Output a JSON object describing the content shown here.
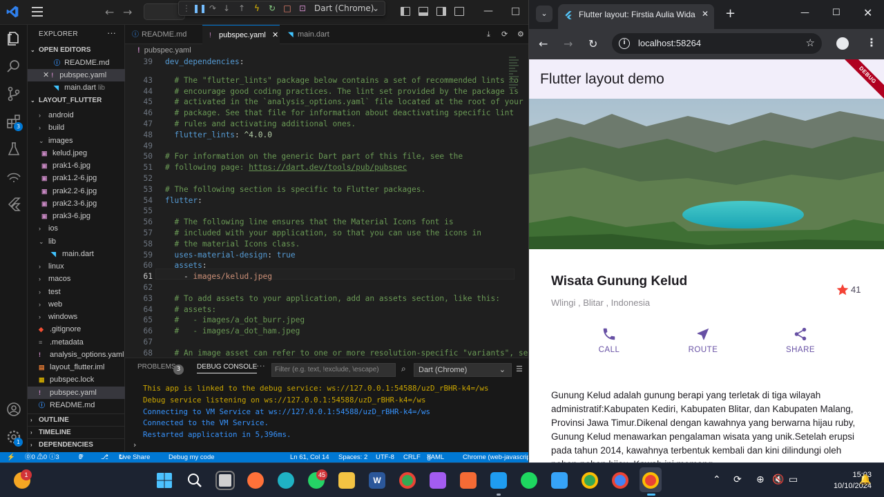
{
  "vscode": {
    "title_select": "Dart (Chrome)",
    "explorer_title": "EXPLORER",
    "open_editors_title": "OPEN EDITORS",
    "open_editors": [
      {
        "name": "README.md",
        "extra": ""
      },
      {
        "name": "pubspec.yaml",
        "extra": ""
      },
      {
        "name": "main.dart",
        "extra": "lib"
      }
    ],
    "project_title": "LAYOUT_FLUTTER",
    "tree": [
      {
        "name": "android",
        "type": "folder"
      },
      {
        "name": "build",
        "type": "folder"
      },
      {
        "name": "images",
        "type": "folder-open"
      },
      {
        "name": "kelud.jpeg",
        "type": "image"
      },
      {
        "name": "prak1-6.jpg",
        "type": "image"
      },
      {
        "name": "prak1.2-6.jpg",
        "type": "image"
      },
      {
        "name": "prak2.2-6.jpg",
        "type": "image"
      },
      {
        "name": "prak2.3-6.jpg",
        "type": "image"
      },
      {
        "name": "prak3-6.jpg",
        "type": "image"
      },
      {
        "name": "ios",
        "type": "folder"
      },
      {
        "name": "lib",
        "type": "folder-open"
      },
      {
        "name": "main.dart",
        "type": "dart"
      },
      {
        "name": "linux",
        "type": "folder"
      },
      {
        "name": "macos",
        "type": "folder"
      },
      {
        "name": "test",
        "type": "folder"
      },
      {
        "name": "web",
        "type": "folder"
      },
      {
        "name": "windows",
        "type": "folder"
      },
      {
        "name": ".gitignore",
        "type": "git"
      },
      {
        "name": ".metadata",
        "type": "meta"
      },
      {
        "name": "analysis_options.yaml",
        "type": "yaml"
      },
      {
        "name": "layout_flutter.iml",
        "type": "iml"
      },
      {
        "name": "pubspec.lock",
        "type": "lock"
      },
      {
        "name": "pubspec.yaml",
        "type": "yaml"
      },
      {
        "name": "README.md",
        "type": "info"
      }
    ],
    "outline_title": "OUTLINE",
    "timeline_title": "TIMELINE",
    "dependencies_title": "DEPENDENCIES",
    "tabs": [
      {
        "label": "README.md"
      },
      {
        "label": "pubspec.yaml"
      },
      {
        "label": "main.dart"
      }
    ],
    "breadcrumb": "pubspec.yaml",
    "code_lines": [
      {
        "n": "39",
        "t": "dev_dependencies:"
      },
      {
        "n": "43",
        "t": "  # The \"flutter_lints\" package below contains a set of recommended lints to"
      },
      {
        "n": "44",
        "t": "  # encourage good coding practices. The lint set provided by the package is"
      },
      {
        "n": "45",
        "t": "  # activated in the `analysis_options.yaml` file located at the root of your"
      },
      {
        "n": "46",
        "t": "  # package. See that file for information about deactivating specific lint"
      },
      {
        "n": "47",
        "t": "  # rules and activating additional ones."
      },
      {
        "n": "48",
        "t": "  flutter_lints: ^4.0.0"
      },
      {
        "n": "49",
        "t": ""
      },
      {
        "n": "50",
        "t": "# For information on the generic Dart part of this file, see the"
      },
      {
        "n": "51",
        "t": "# following page: https://dart.dev/tools/pub/pubspec"
      },
      {
        "n": "52",
        "t": ""
      },
      {
        "n": "53",
        "t": "# The following section is specific to Flutter packages."
      },
      {
        "n": "54",
        "t": "flutter:"
      },
      {
        "n": "55",
        "t": ""
      },
      {
        "n": "56",
        "t": "  # The following line ensures that the Material Icons font is"
      },
      {
        "n": "57",
        "t": "  # included with your application, so that you can use the icons in"
      },
      {
        "n": "58",
        "t": "  # the material Icons class."
      },
      {
        "n": "59",
        "t": "  uses-material-design: true"
      },
      {
        "n": "60",
        "t": "  assets:"
      },
      {
        "n": "61",
        "t": "    - images/kelud.jpeg"
      },
      {
        "n": "62",
        "t": ""
      },
      {
        "n": "63",
        "t": "  # To add assets to your application, add an assets section, like this:"
      },
      {
        "n": "64",
        "t": "  # assets:"
      },
      {
        "n": "65",
        "t": "  #   - images/a_dot_burr.jpeg"
      },
      {
        "n": "66",
        "t": "  #   - images/a_dot_ham.jpeg"
      },
      {
        "n": "67",
        "t": ""
      },
      {
        "n": "68",
        "t": "  # An image asset can refer to one or more resolution-specific \"variants\", see"
      }
    ],
    "panel": {
      "problems_label": "PROBLEMS",
      "problems_count": "3",
      "debug_console_label": "DEBUG CONSOLE",
      "filter_placeholder": "Filter (e.g. text, !exclude, \\escape)",
      "select_value": "Dart (Chrome)",
      "output": [
        {
          "text": "This app is linked to the debug service: ws://127.0.0.1:54588/uzD_rBHR-k4=/ws",
          "color": "#cca700"
        },
        {
          "text": "Debug service listening on ws://127.0.0.1:54588/uzD_rBHR-k4=/ws",
          "color": "#cca700"
        },
        {
          "text": "Connecting to VM Service at ws://127.0.0.1:54588/uzD_rBHR-k4=/ws",
          "color": "#3794ff"
        },
        {
          "text": "Connected to the VM Service.",
          "color": "#3794ff"
        },
        {
          "text": "Restarted application in 5,396ms.",
          "color": "#3794ff"
        }
      ]
    },
    "status": {
      "problems": "⓪0 ⚠0 ⓘ3",
      "ports": "0",
      "live_share": "Live Share",
      "debug": "Debug my code",
      "position": "Ln 61, Col 14",
      "spaces": "Spaces: 2",
      "encoding": "UTF-8",
      "eol": "CRLF",
      "language": "YAML",
      "device": "Chrome (web-javascript)"
    }
  },
  "chrome": {
    "tab_title": "Flutter layout: Firstia Aulia Wida",
    "url": "localhost:58264",
    "app": {
      "appbar_title": "Flutter layout demo",
      "debug_banner": "DEBUG",
      "title": "Wisata Gunung Kelud",
      "location": "Wlingi , Blitar , Indonesia",
      "star_count": "41",
      "actions": [
        {
          "label": "CALL",
          "icon": "phone-icon"
        },
        {
          "label": "ROUTE",
          "icon": "near-me-icon"
        },
        {
          "label": "SHARE",
          "icon": "share-icon"
        }
      ],
      "description": "Gunung Kelud adalah gunung berapi yang terletak di tiga wilayah administratif:Kabupaten Kediri, Kabupaten Blitar, dan Kabupaten Malang, Provinsi Jawa Timur.Dikenal dengan kawahnya yang berwarna hijau ruby, Gunung Kelud menawarkan pengalaman wisata yang unik.Setelah erupsi pada tahun 2014, kawahnya terbentuk kembali dan kini dilindungi oleh pohon-pohon hijau. Kawah ini memang",
      "accent_color": "#6750a4",
      "star_color": "#f44336"
    }
  },
  "taskbar": {
    "notification_badge": "1",
    "whatsapp_badge": "45",
    "time": "15:03",
    "date": "10/10/2024"
  }
}
